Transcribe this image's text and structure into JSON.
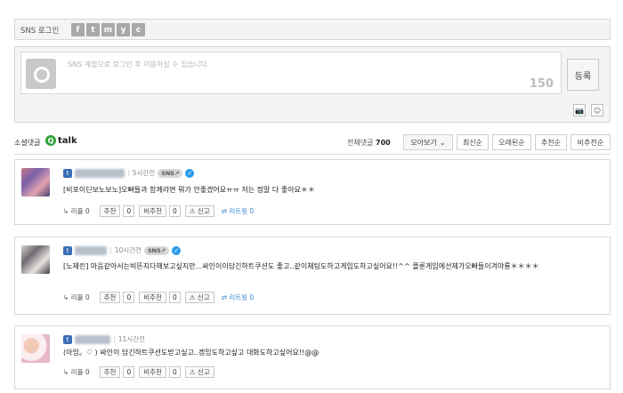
{
  "login": {
    "label": "SNS 로그인",
    "icons": [
      {
        "name": "facebook-icon",
        "glyph": "f"
      },
      {
        "name": "twitter-icon",
        "glyph": "t"
      },
      {
        "name": "me2day-icon",
        "glyph": "m"
      },
      {
        "name": "yozm-icon",
        "glyph": "y"
      },
      {
        "name": "cyworld-icon",
        "glyph": "c"
      }
    ]
  },
  "compose": {
    "placeholder": "SNS 계정으로 로그인 후 이용하실 수 있습니다.",
    "counter": "150",
    "submit_label": "등록",
    "camera_icon": "📷",
    "emoticon_icon": "☺"
  },
  "header": {
    "title": "소셜댓글",
    "brand": "talk",
    "total_label": "전체댓글",
    "total_count": "700",
    "view_label": "모아보기",
    "sorts": [
      "최신순",
      "오래된순",
      "추천순",
      "비추천순"
    ]
  },
  "comments": [
    {
      "time": "5시간전",
      "sns_badge": "SNS↗",
      "text": "[비포이딘보노보노]오빠들과 함께라면 뭐가 안좋겠어요ㅠㅠ 저는 정말 다 좋아요＊＊",
      "reply_label": "리플",
      "reply_count": "0",
      "up_label": "추천",
      "up_count": "0",
      "down_label": "비추천",
      "down_count": "0",
      "report_label": "신고",
      "retweet_label": "리트윗",
      "retweet_count": "0"
    },
    {
      "time": "10시간전",
      "sns_badge": "SNS↗",
      "text": "[노제린] 마음같아서는빅뜬지다해보고싶지만...싸인이이담긴하트쿠션도 좋고..같이체팅도하고게임도하고싶어요!!^^ 플룬게임에선제가오빠들이겨야룡＊＊＊＊",
      "reply_label": "리플",
      "reply_count": "0",
      "up_label": "추천",
      "up_count": "0",
      "down_label": "비추천",
      "down_count": "0",
      "report_label": "신고",
      "retweet_label": "리트윗",
      "retweet_count": "0"
    },
    {
      "time": "11시간전",
      "text": "(아잉。♡ ) 싸인이 담긴하트쿠션도받고싶고..겜잉도하고싶고 대화도하고싶어요!!@@",
      "reply_label": "리플",
      "reply_count": "0",
      "up_label": "추천",
      "up_count": "0",
      "down_label": "비추천",
      "down_count": "0",
      "report_label": "신고"
    }
  ]
}
